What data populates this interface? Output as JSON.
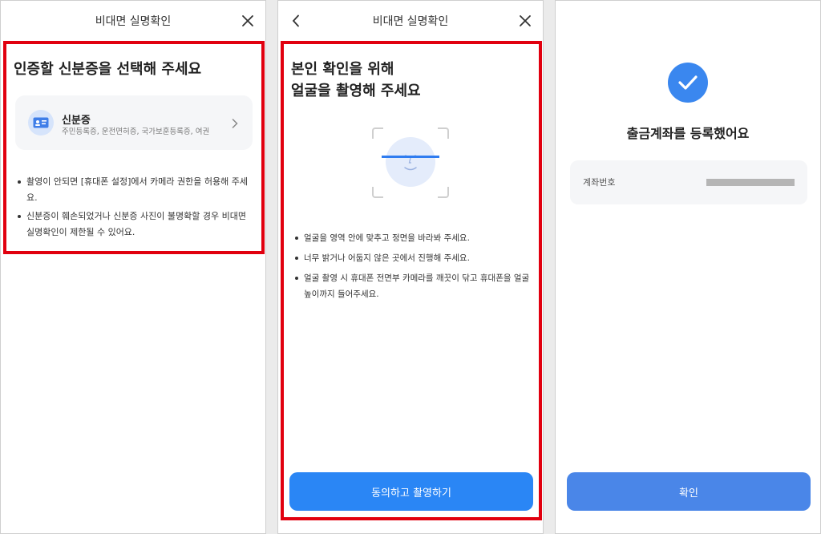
{
  "screen1": {
    "nav_title": "비대면 실명확인",
    "heading": "인증할 신분증을 선택해 주세요",
    "id_option": {
      "title": "신분증",
      "subtitle": "주민등록증, 운전면허증, 국가보훈등록증, 여권",
      "icon": "id-card-icon"
    },
    "notes": [
      "촬영이 안되면 [휴대폰 설정]에서 카메라 권한을 허용해 주세요.",
      "신분증이 훼손되었거나 신분증 사진이 불명확할 경우 비대면 실명확인이 제한될 수 있어요."
    ]
  },
  "screen2": {
    "nav_title": "비대면 실명확인",
    "heading_line1": "본인 확인을 위해",
    "heading_line2": "얼굴을 촬영해 주세요",
    "tips": [
      "얼굴을 영역 안에 맞추고 정면을 바라봐 주세요.",
      "너무 밝거나 어둡지 않은 곳에서 진행해 주세요.",
      "얼굴 촬영 시 휴대폰 전면부 카메라를 깨끗이 닦고 휴대폰을 얼굴 높이까지 들어주세요."
    ],
    "button_label": "동의하고 촬영하기"
  },
  "screen3": {
    "title": "출금계좌를 등록했어요",
    "account_label": "계좌번호",
    "button_label": "확인"
  },
  "colors": {
    "highlight": "#e1000f",
    "primary": "#2a86f5",
    "confirm": "#4a86e8",
    "check": "#3a87ef"
  }
}
